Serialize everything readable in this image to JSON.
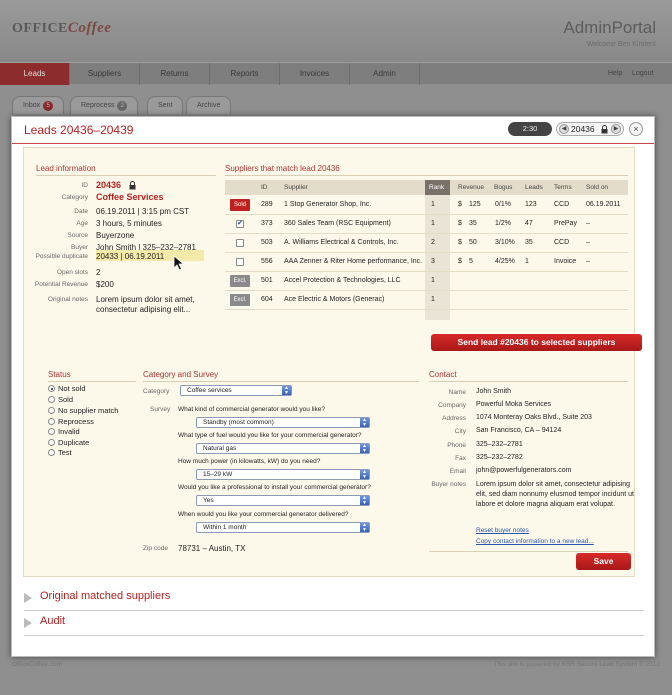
{
  "app": {
    "logo_office": "OFFICE",
    "logo_coffee": "Coffee",
    "title": "AdminPortal",
    "subtitle": "Welcome Ben Kirsten!"
  },
  "nav": {
    "tabs": [
      "Leads",
      "Suppliers",
      "Returns",
      "Reports",
      "Invoices",
      "Admin"
    ],
    "active": "Leads",
    "help": "Help",
    "logout": "Logout"
  },
  "subtabs": {
    "inbox": {
      "label": "Inbox",
      "count": "5"
    },
    "reprocess": {
      "label": "Reprocess",
      "count": "2"
    },
    "sent": {
      "label": "Sent"
    },
    "archive": {
      "label": "Archive"
    }
  },
  "modal": {
    "title": "Leads 20436–20439",
    "timer": "2:30",
    "lead_number": "20436",
    "close": "×"
  },
  "lead_info": {
    "heading": "Lead information",
    "fields": [
      {
        "label": "ID",
        "value": "20436"
      },
      {
        "label": "Category",
        "value": "Coffee Services"
      },
      {
        "label": "Date",
        "value": "06.19.2011  |  3:15 pm CST"
      },
      {
        "label": "Age",
        "value": "3 hours, 5 minutes"
      },
      {
        "label": "Source",
        "value": "Buyerzone"
      },
      {
        "label": "Buyer",
        "value": "John Smith  |  325–232–2781"
      },
      {
        "label": "Possible duplicate",
        "value": "20433  |  06.19.2011"
      },
      {
        "label": "Open slots",
        "value": "2"
      },
      {
        "label": "Potential Revenue",
        "value": "$200"
      },
      {
        "label": "Original notes",
        "value": "Lorem ipsum dolor sit amet, consectetur adipising elit..."
      }
    ]
  },
  "suppliers": {
    "heading": "Suppliers that match lead 20436",
    "columns": [
      "ID",
      "Supplier",
      "Rank",
      "Revenue",
      "Bogus",
      "Leads",
      "Terms",
      "Sold on"
    ],
    "rows": [
      {
        "status": "Sold",
        "id": "289",
        "name": "1 Stop Generator Shop, Inc.",
        "rank": "1",
        "cur": "$",
        "revenue": "125",
        "bogus": "0/1%",
        "leads": "123",
        "terms": "CCD",
        "sold_on": "06.19.2011"
      },
      {
        "status": "checked",
        "id": "373",
        "name": "360 Sales Team (RSC Equipment)",
        "rank": "1",
        "cur": "$",
        "revenue": "35",
        "bogus": "1/2%",
        "leads": "47",
        "terms": "PrePay",
        "sold_on": "–"
      },
      {
        "status": "unchecked",
        "id": "503",
        "name": "A. Williams Electrical & Controls, Inc.",
        "rank": "2",
        "cur": "$",
        "revenue": "50",
        "bogus": "3/10%",
        "leads": "35",
        "terms": "CCD",
        "sold_on": "–"
      },
      {
        "status": "unchecked",
        "id": "556",
        "name": "AAA Zenner & Riter Home performance, Inc.",
        "rank": "3",
        "cur": "$",
        "revenue": "5",
        "bogus": "4/25%",
        "leads": "1",
        "terms": "Invoice",
        "sold_on": "–"
      },
      {
        "status": "Excl.",
        "id": "501",
        "name": "Accel Protection & Technologies, LLC",
        "rank": "1",
        "cur": "",
        "revenue": "",
        "bogus": "",
        "leads": "",
        "terms": "",
        "sold_on": ""
      },
      {
        "status": "Excl.",
        "id": "604",
        "name": "Ace Electric & Motors (Generac)",
        "rank": "1",
        "cur": "",
        "revenue": "",
        "bogus": "",
        "leads": "",
        "terms": "",
        "sold_on": ""
      }
    ],
    "send_button": "Send lead #20436 to selected suppliers"
  },
  "status": {
    "heading": "Status",
    "options": [
      "Not sold",
      "Sold",
      "No supplier match",
      "Reprocess",
      "Invalid",
      "Duplicate",
      "Test"
    ],
    "selected": "Not sold"
  },
  "survey": {
    "heading": "Category and Survey",
    "category_label": "Category",
    "category_value": "Coffee services",
    "survey_label": "Survey",
    "questions": [
      {
        "q": "What kind of commercial generator would you like?",
        "a": "Standby (most common)"
      },
      {
        "q": "What type of fuel would you like for your commercial generator?",
        "a": "Natural gas"
      },
      {
        "q": "How much power (in kilowatts, kW) do you need?",
        "a": "15–29 kW"
      },
      {
        "q": "Would you like a professional to install your commercial generator?",
        "a": "Yes"
      },
      {
        "q": "When would you like your commercial generator delivered?",
        "a": "Within 1 month"
      }
    ],
    "zip_label": "Zip code",
    "zip_value": "78731 – Austin, TX"
  },
  "contact": {
    "heading": "Contact",
    "fields": [
      {
        "label": "Name",
        "value": "John Smith"
      },
      {
        "label": "Company",
        "value": "Powerful Moka Services"
      },
      {
        "label": "Address",
        "value": "1074 Monteray Oaks Blvd., Suite 203"
      },
      {
        "label": "City",
        "value": "San Francisco, CA – 94124"
      },
      {
        "label": "Phone",
        "value": "325–232–2781"
      },
      {
        "label": "Fax",
        "value": "325–232–2782"
      },
      {
        "label": "Email",
        "value": "john@powerfulgenerators.com"
      },
      {
        "label": "Buyer notes",
        "value": "Lorem ipsum dolor sit amet, consectetur adipising elit, sed diam nonnumy elusmod tempor incidunt ut labore et dolore magna aliquam erat volupat."
      }
    ],
    "reset_link": "Reset buyer notes",
    "copy_link": "Copy contact information to a new lead..."
  },
  "save_button": "Save",
  "accordions": [
    "Original matched suppliers",
    "Audit"
  ],
  "footer": {
    "left": "OfficeCoffee.com",
    "right": "This site is powered by KSR Secure Lead System © 2012"
  },
  "colors": {
    "accent": "#b51f1f",
    "panel_bg": "#fdf9ea",
    "link": "#2a55b0"
  }
}
